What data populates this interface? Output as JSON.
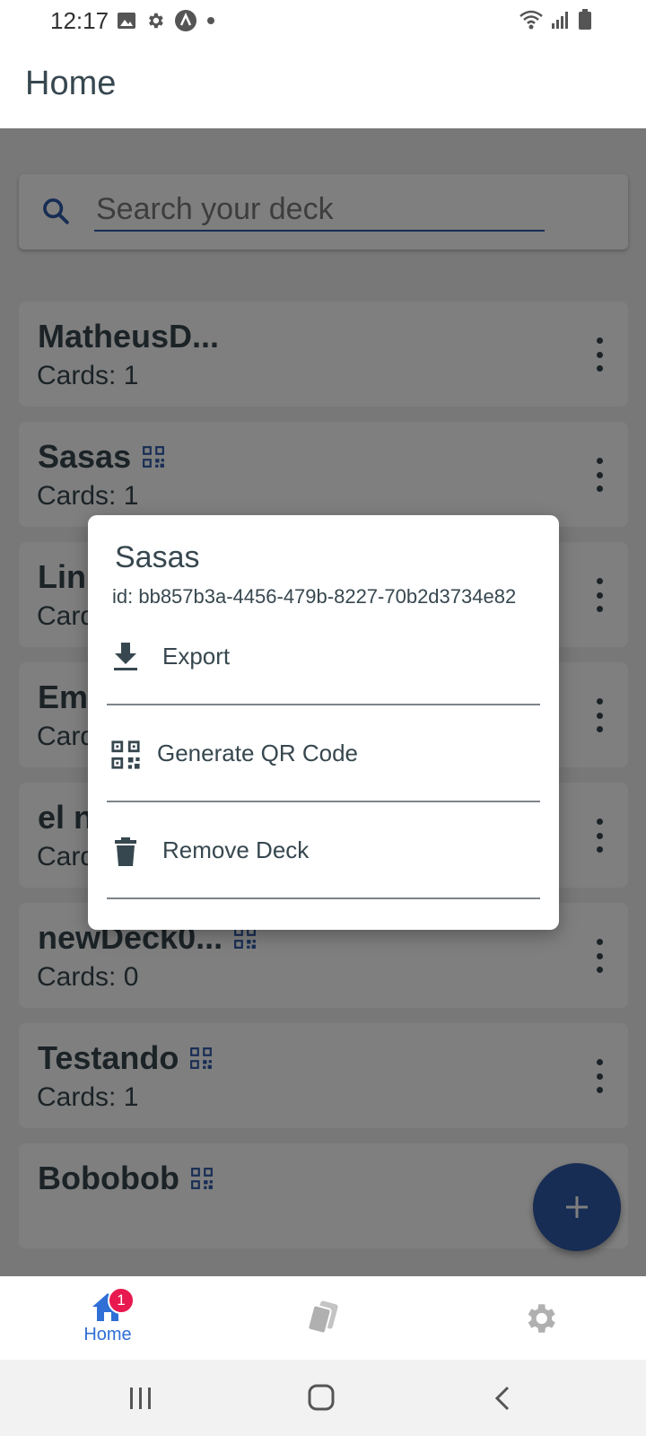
{
  "status_bar": {
    "time": "12:17"
  },
  "app_bar": {
    "title": "Home"
  },
  "search": {
    "placeholder": "Search your deck"
  },
  "decks": [
    {
      "name": "MatheusD...",
      "count": "Cards: 1",
      "qr": false
    },
    {
      "name": "Sasas",
      "count": "Cards: 1",
      "qr": true
    },
    {
      "name": "Linu",
      "count": "Card",
      "qr": false
    },
    {
      "name": "Emi",
      "count": "Card",
      "qr": false
    },
    {
      "name": "el n",
      "count": "Card",
      "qr": false
    },
    {
      "name": "newDeck0...",
      "count": "Cards: 0",
      "qr": true
    },
    {
      "name": "Testando",
      "count": "Cards: 1",
      "qr": true
    },
    {
      "name": "Bobobob",
      "count": "",
      "qr": true
    }
  ],
  "fab": {
    "icon": "plus-icon"
  },
  "dialog": {
    "title": "Sasas",
    "id_text": "id: bb857b3a-4456-479b-8227-70b2d3734e82",
    "options": [
      {
        "label": "Export",
        "icon": "download-icon"
      },
      {
        "label": "Generate QR Code",
        "icon": "qr-code-icon"
      },
      {
        "label": "Remove Deck",
        "icon": "trash-icon"
      }
    ]
  },
  "bottom_nav": {
    "home_label": "Home",
    "home_badge": "1",
    "active_color": "#2f6fd6",
    "inactive_color": "#b0b0b0"
  },
  "colors": {
    "primary": "#2f5aa8",
    "text": "#37474f",
    "badge": "#e8194f"
  }
}
